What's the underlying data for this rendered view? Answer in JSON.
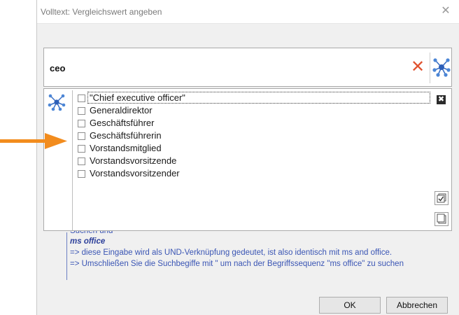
{
  "window": {
    "title": "Volltext: Vergleichswert angeben",
    "close_glyph": "✕"
  },
  "search": {
    "value": "ceo",
    "clear_glyph": "✕",
    "clear_icon": "clear-x-icon",
    "network_icon": "synonym-network-icon"
  },
  "synonyms": {
    "close_glyph": "✖",
    "items": [
      {
        "label": "\"Chief executive officer\"",
        "checked": false
      },
      {
        "label": "Generaldirektor",
        "checked": false
      },
      {
        "label": "Geschäftsführer",
        "checked": false
      },
      {
        "label": "Geschäftsführerin",
        "checked": false
      },
      {
        "label": "Vorstandsmitglied",
        "checked": false
      },
      {
        "label": "Vorstandsvorsitzende",
        "checked": false
      },
      {
        "label": "Vorstandsvorsitzender",
        "checked": false
      }
    ],
    "side_buttons": [
      "check-all-icon",
      "pages-icon"
    ]
  },
  "help": {
    "cut_line": "Suchen und",
    "example": "ms office",
    "line1": "=> diese Eingabe wird als UND-Verknüpfung gedeutet, ist also identisch mit ms and office.",
    "line2": "=> Umschließen Sie die Suchbegiffe mit \" um nach der Begriffssequenz \"ms office\" zu suchen"
  },
  "buttons": {
    "ok": "OK",
    "cancel": "Abbrechen"
  },
  "colors": {
    "accent_orange": "#f28c1e",
    "clear_red": "#e0522f",
    "icon_blue": "#3a6fc4",
    "help_blue": "#3a55b4"
  }
}
